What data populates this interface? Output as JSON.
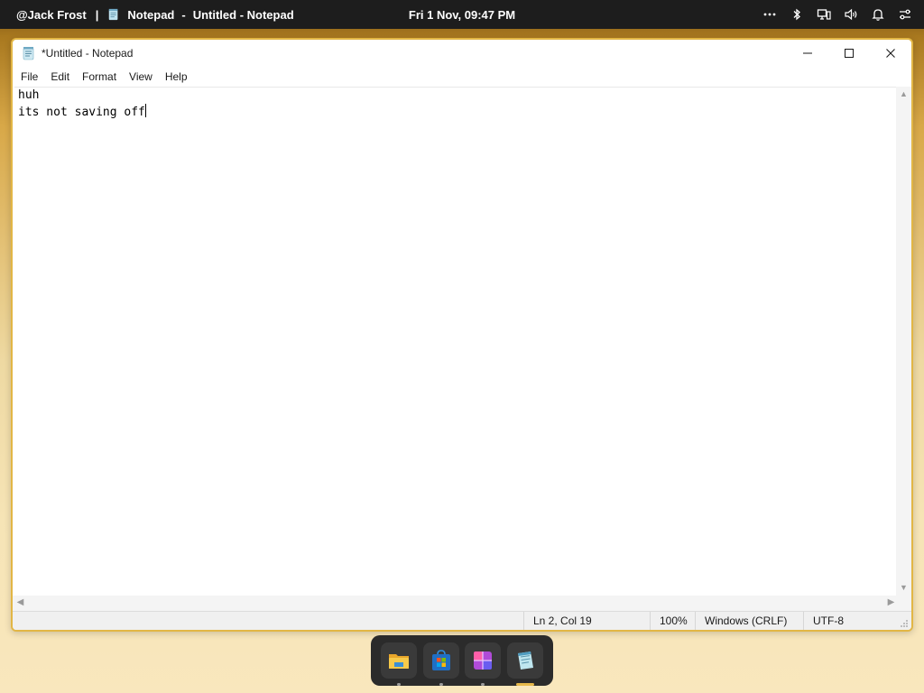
{
  "topbar": {
    "user": "@Jack Frost",
    "separator": "|",
    "app_name": "Notepad",
    "dash": "-",
    "window_title": "Untitled - Notepad",
    "clock": "Fri 1 Nov, 09:47 PM",
    "icons": [
      "more-icon",
      "bluetooth-icon",
      "display-icon",
      "volume-icon",
      "bell-icon",
      "settings-sliders-icon"
    ]
  },
  "window": {
    "title": "*Untitled - Notepad",
    "menu": [
      "File",
      "Edit",
      "Format",
      "View",
      "Help"
    ],
    "content_lines": [
      "huh",
      "its not saving off"
    ],
    "status": {
      "position": "Ln 2, Col 19",
      "zoom": "100%",
      "line_ending": "Windows (CRLF)",
      "encoding": "UTF-8"
    }
  },
  "dock": {
    "apps": [
      "file-explorer-icon",
      "microsoft-store-icon",
      "photos-app-icon",
      "notepad-icon"
    ],
    "active_app": "notepad-icon"
  },
  "colors": {
    "accent": "#e2b645",
    "topbar_bg": "#1d1d1d",
    "dock_bg": "#2b2b2b"
  }
}
